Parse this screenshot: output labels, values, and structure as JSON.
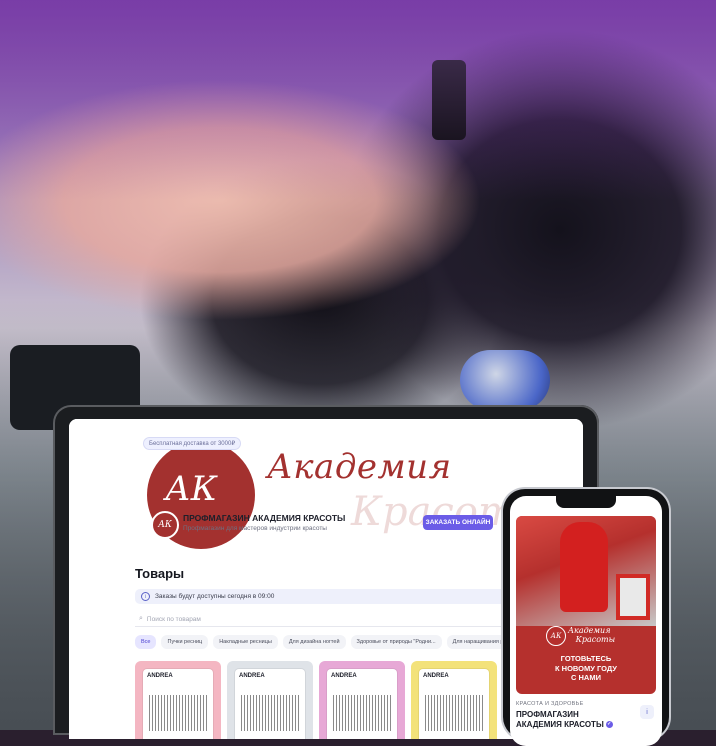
{
  "hero": {
    "badge": "Бесплатная доставка от 3000₽",
    "logo_initials": "АК",
    "script_title": "Академия",
    "script_sub": "Красоты",
    "store_name": "ПРОФМАГАЗИН АКАДЕМИЯ КРАСОТЫ",
    "store_desc": "Профмагазин для мастеров индустрии красоты",
    "order_button": "ЗАКАЗАТЬ ОНЛАЙН"
  },
  "products": {
    "title": "Товары",
    "notice": "Заказы будут доступны сегодня в 09:00",
    "search_placeholder": "Поиск по товарам",
    "categories": [
      "Все",
      "Пучки ресниц",
      "Накладные ресницы",
      "Для дизайна ногтей",
      "Здоровье от природы \"Родни...",
      "Для наращивания ресниц"
    ],
    "cards": [
      {
        "brand": "ANDREA",
        "color": "#f4b6c2"
      },
      {
        "brand": "ANDREA",
        "color": "#dfe3e8"
      },
      {
        "brand": "ANDREA",
        "color": "#e7a8d6"
      },
      {
        "brand": "ANDREA",
        "color": "#f3e27a"
      }
    ]
  },
  "phone": {
    "emblem_text": "Академия\n   Красоты",
    "greeting": "ГОТОВЬТЕСЬ\nК НОВОМУ ГОДУ\nС НАМИ",
    "category_label": "КРАСОТА И ЗДОРОВЬЕ",
    "shop_name": "ПРОФМАГАЗИН\nАКАДЕМИЯ КРАСОТЫ"
  }
}
